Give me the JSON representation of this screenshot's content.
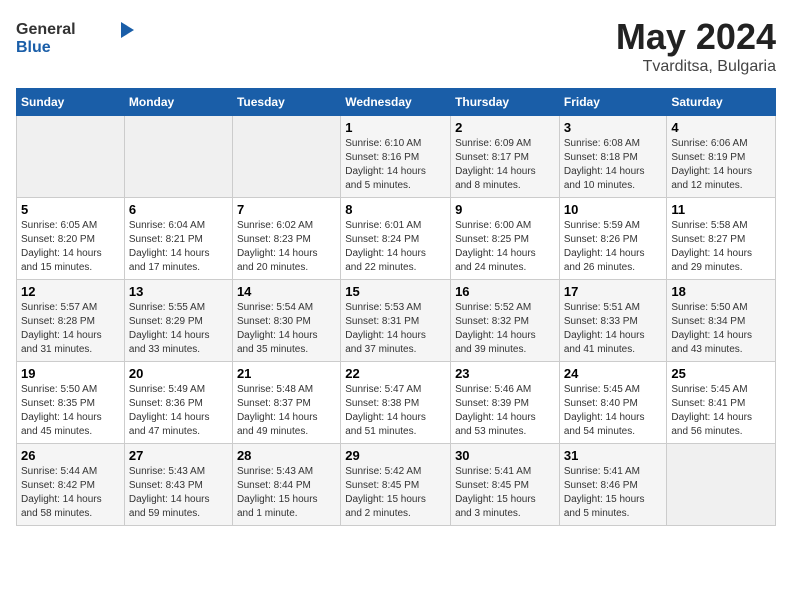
{
  "header": {
    "logo_general": "General",
    "logo_blue": "Blue",
    "title": "May 2024",
    "location": "Tvarditsa, Bulgaria"
  },
  "weekdays": [
    "Sunday",
    "Monday",
    "Tuesday",
    "Wednesday",
    "Thursday",
    "Friday",
    "Saturday"
  ],
  "weeks": [
    [
      {
        "day": "",
        "info": ""
      },
      {
        "day": "",
        "info": ""
      },
      {
        "day": "",
        "info": ""
      },
      {
        "day": "1",
        "info": "Sunrise: 6:10 AM\nSunset: 8:16 PM\nDaylight: 14 hours\nand 5 minutes."
      },
      {
        "day": "2",
        "info": "Sunrise: 6:09 AM\nSunset: 8:17 PM\nDaylight: 14 hours\nand 8 minutes."
      },
      {
        "day": "3",
        "info": "Sunrise: 6:08 AM\nSunset: 8:18 PM\nDaylight: 14 hours\nand 10 minutes."
      },
      {
        "day": "4",
        "info": "Sunrise: 6:06 AM\nSunset: 8:19 PM\nDaylight: 14 hours\nand 12 minutes."
      }
    ],
    [
      {
        "day": "5",
        "info": "Sunrise: 6:05 AM\nSunset: 8:20 PM\nDaylight: 14 hours\nand 15 minutes."
      },
      {
        "day": "6",
        "info": "Sunrise: 6:04 AM\nSunset: 8:21 PM\nDaylight: 14 hours\nand 17 minutes."
      },
      {
        "day": "7",
        "info": "Sunrise: 6:02 AM\nSunset: 8:23 PM\nDaylight: 14 hours\nand 20 minutes."
      },
      {
        "day": "8",
        "info": "Sunrise: 6:01 AM\nSunset: 8:24 PM\nDaylight: 14 hours\nand 22 minutes."
      },
      {
        "day": "9",
        "info": "Sunrise: 6:00 AM\nSunset: 8:25 PM\nDaylight: 14 hours\nand 24 minutes."
      },
      {
        "day": "10",
        "info": "Sunrise: 5:59 AM\nSunset: 8:26 PM\nDaylight: 14 hours\nand 26 minutes."
      },
      {
        "day": "11",
        "info": "Sunrise: 5:58 AM\nSunset: 8:27 PM\nDaylight: 14 hours\nand 29 minutes."
      }
    ],
    [
      {
        "day": "12",
        "info": "Sunrise: 5:57 AM\nSunset: 8:28 PM\nDaylight: 14 hours\nand 31 minutes."
      },
      {
        "day": "13",
        "info": "Sunrise: 5:55 AM\nSunset: 8:29 PM\nDaylight: 14 hours\nand 33 minutes."
      },
      {
        "day": "14",
        "info": "Sunrise: 5:54 AM\nSunset: 8:30 PM\nDaylight: 14 hours\nand 35 minutes."
      },
      {
        "day": "15",
        "info": "Sunrise: 5:53 AM\nSunset: 8:31 PM\nDaylight: 14 hours\nand 37 minutes."
      },
      {
        "day": "16",
        "info": "Sunrise: 5:52 AM\nSunset: 8:32 PM\nDaylight: 14 hours\nand 39 minutes."
      },
      {
        "day": "17",
        "info": "Sunrise: 5:51 AM\nSunset: 8:33 PM\nDaylight: 14 hours\nand 41 minutes."
      },
      {
        "day": "18",
        "info": "Sunrise: 5:50 AM\nSunset: 8:34 PM\nDaylight: 14 hours\nand 43 minutes."
      }
    ],
    [
      {
        "day": "19",
        "info": "Sunrise: 5:50 AM\nSunset: 8:35 PM\nDaylight: 14 hours\nand 45 minutes."
      },
      {
        "day": "20",
        "info": "Sunrise: 5:49 AM\nSunset: 8:36 PM\nDaylight: 14 hours\nand 47 minutes."
      },
      {
        "day": "21",
        "info": "Sunrise: 5:48 AM\nSunset: 8:37 PM\nDaylight: 14 hours\nand 49 minutes."
      },
      {
        "day": "22",
        "info": "Sunrise: 5:47 AM\nSunset: 8:38 PM\nDaylight: 14 hours\nand 51 minutes."
      },
      {
        "day": "23",
        "info": "Sunrise: 5:46 AM\nSunset: 8:39 PM\nDaylight: 14 hours\nand 53 minutes."
      },
      {
        "day": "24",
        "info": "Sunrise: 5:45 AM\nSunset: 8:40 PM\nDaylight: 14 hours\nand 54 minutes."
      },
      {
        "day": "25",
        "info": "Sunrise: 5:45 AM\nSunset: 8:41 PM\nDaylight: 14 hours\nand 56 minutes."
      }
    ],
    [
      {
        "day": "26",
        "info": "Sunrise: 5:44 AM\nSunset: 8:42 PM\nDaylight: 14 hours\nand 58 minutes."
      },
      {
        "day": "27",
        "info": "Sunrise: 5:43 AM\nSunset: 8:43 PM\nDaylight: 14 hours\nand 59 minutes."
      },
      {
        "day": "28",
        "info": "Sunrise: 5:43 AM\nSunset: 8:44 PM\nDaylight: 15 hours\nand 1 minute."
      },
      {
        "day": "29",
        "info": "Sunrise: 5:42 AM\nSunset: 8:45 PM\nDaylight: 15 hours\nand 2 minutes."
      },
      {
        "day": "30",
        "info": "Sunrise: 5:41 AM\nSunset: 8:45 PM\nDaylight: 15 hours\nand 3 minutes."
      },
      {
        "day": "31",
        "info": "Sunrise: 5:41 AM\nSunset: 8:46 PM\nDaylight: 15 hours\nand 5 minutes."
      },
      {
        "day": "",
        "info": ""
      }
    ]
  ]
}
